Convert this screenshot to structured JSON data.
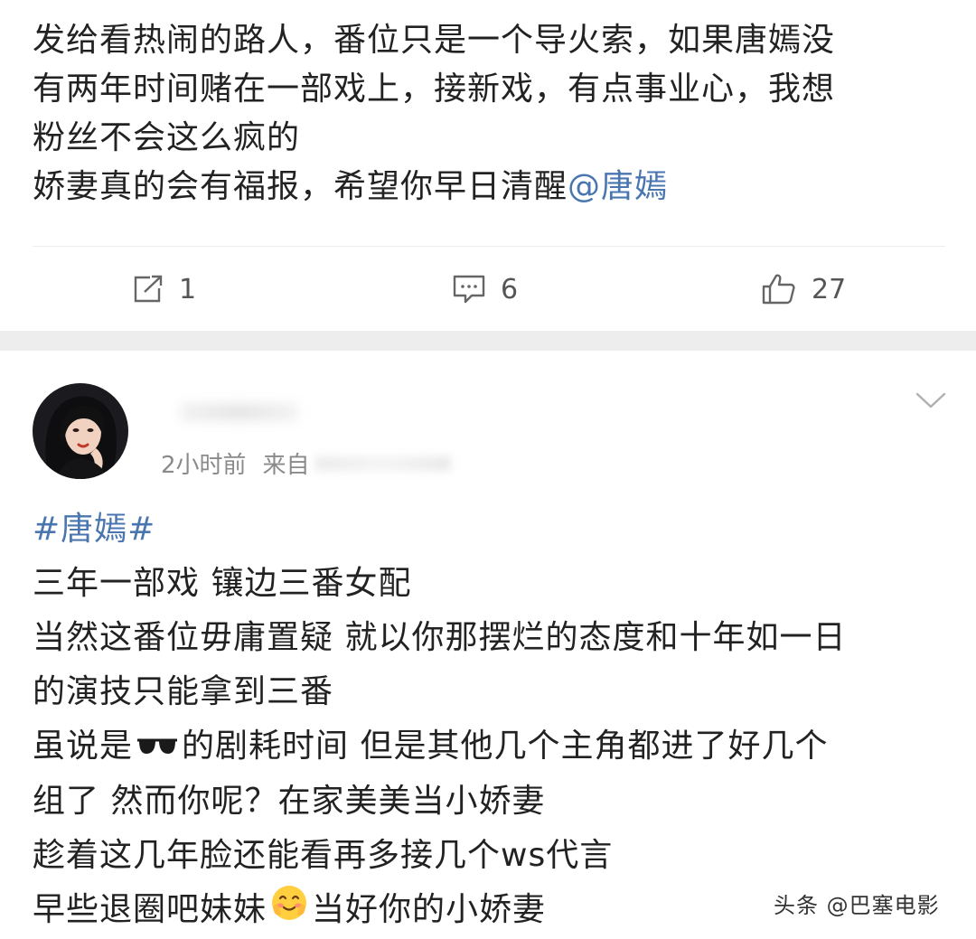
{
  "post1": {
    "lines": [
      "发给看热闹的路人，番位只是一个导火索，如果唐嫣没",
      "有两年时间赌在一部戏上，接新戏，有点事业心，我想",
      "粉丝不会这么疯的"
    ],
    "last_line_text": "娇妻真的会有福报，希望你早日清醒",
    "mention": "@唐嫣",
    "actions": {
      "repost_count": "1",
      "comment_count": "6",
      "like_count": "27"
    }
  },
  "post2": {
    "time_label": "2小时前",
    "source_prefix": "来自",
    "hashtag": "#唐嫣#",
    "lines": [
      "三年一部戏 镶边三番女配",
      "当然这番位毋庸置疑 就以你那摆烂的态度和十年如一日",
      "的演技只能拿到三番"
    ],
    "line_emoji_before": "虽说是",
    "line_emoji_after": "的剧耗时间 但是其他几个主角都进了好几个",
    "lines_after": [
      "组了 然而你呢？在家美美当小娇妻",
      "趁着这几年脸还能看再多接几个ws代言"
    ],
    "last_before": "早些退圈吧妹妹",
    "last_after": "当好你的小娇妻"
  },
  "watermark": "头条 @巴塞电影",
  "icons": {
    "repost": "repost-icon",
    "comment": "comment-icon",
    "like": "thumbs-up-icon",
    "chevron": "chevron-down-icon",
    "sunglasses": "sunglasses-icon",
    "smile": "blushing-face-icon"
  },
  "colors": {
    "link": "#4a76b0",
    "separator": "#ededed"
  }
}
